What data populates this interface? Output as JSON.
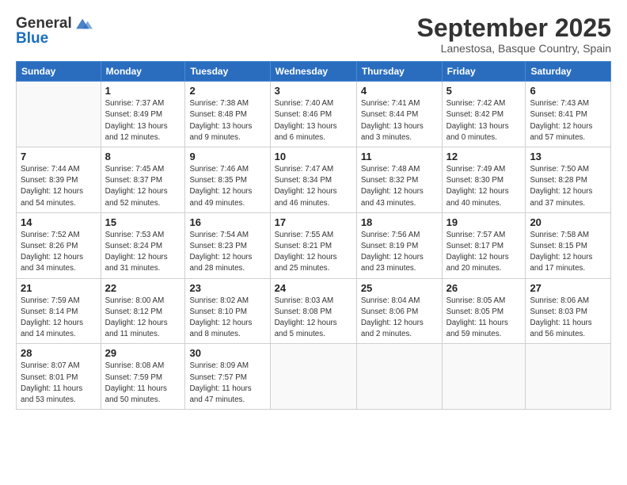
{
  "header": {
    "logo_line1": "General",
    "logo_line2": "Blue",
    "month_title": "September 2025",
    "location": "Lanestosa, Basque Country, Spain"
  },
  "weekdays": [
    "Sunday",
    "Monday",
    "Tuesday",
    "Wednesday",
    "Thursday",
    "Friday",
    "Saturday"
  ],
  "weeks": [
    [
      {
        "day": "",
        "info": ""
      },
      {
        "day": "1",
        "info": "Sunrise: 7:37 AM\nSunset: 8:49 PM\nDaylight: 13 hours\nand 12 minutes."
      },
      {
        "day": "2",
        "info": "Sunrise: 7:38 AM\nSunset: 8:48 PM\nDaylight: 13 hours\nand 9 minutes."
      },
      {
        "day": "3",
        "info": "Sunrise: 7:40 AM\nSunset: 8:46 PM\nDaylight: 13 hours\nand 6 minutes."
      },
      {
        "day": "4",
        "info": "Sunrise: 7:41 AM\nSunset: 8:44 PM\nDaylight: 13 hours\nand 3 minutes."
      },
      {
        "day": "5",
        "info": "Sunrise: 7:42 AM\nSunset: 8:42 PM\nDaylight: 13 hours\nand 0 minutes."
      },
      {
        "day": "6",
        "info": "Sunrise: 7:43 AM\nSunset: 8:41 PM\nDaylight: 12 hours\nand 57 minutes."
      }
    ],
    [
      {
        "day": "7",
        "info": "Sunrise: 7:44 AM\nSunset: 8:39 PM\nDaylight: 12 hours\nand 54 minutes."
      },
      {
        "day": "8",
        "info": "Sunrise: 7:45 AM\nSunset: 8:37 PM\nDaylight: 12 hours\nand 52 minutes."
      },
      {
        "day": "9",
        "info": "Sunrise: 7:46 AM\nSunset: 8:35 PM\nDaylight: 12 hours\nand 49 minutes."
      },
      {
        "day": "10",
        "info": "Sunrise: 7:47 AM\nSunset: 8:34 PM\nDaylight: 12 hours\nand 46 minutes."
      },
      {
        "day": "11",
        "info": "Sunrise: 7:48 AM\nSunset: 8:32 PM\nDaylight: 12 hours\nand 43 minutes."
      },
      {
        "day": "12",
        "info": "Sunrise: 7:49 AM\nSunset: 8:30 PM\nDaylight: 12 hours\nand 40 minutes."
      },
      {
        "day": "13",
        "info": "Sunrise: 7:50 AM\nSunset: 8:28 PM\nDaylight: 12 hours\nand 37 minutes."
      }
    ],
    [
      {
        "day": "14",
        "info": "Sunrise: 7:52 AM\nSunset: 8:26 PM\nDaylight: 12 hours\nand 34 minutes."
      },
      {
        "day": "15",
        "info": "Sunrise: 7:53 AM\nSunset: 8:24 PM\nDaylight: 12 hours\nand 31 minutes."
      },
      {
        "day": "16",
        "info": "Sunrise: 7:54 AM\nSunset: 8:23 PM\nDaylight: 12 hours\nand 28 minutes."
      },
      {
        "day": "17",
        "info": "Sunrise: 7:55 AM\nSunset: 8:21 PM\nDaylight: 12 hours\nand 25 minutes."
      },
      {
        "day": "18",
        "info": "Sunrise: 7:56 AM\nSunset: 8:19 PM\nDaylight: 12 hours\nand 23 minutes."
      },
      {
        "day": "19",
        "info": "Sunrise: 7:57 AM\nSunset: 8:17 PM\nDaylight: 12 hours\nand 20 minutes."
      },
      {
        "day": "20",
        "info": "Sunrise: 7:58 AM\nSunset: 8:15 PM\nDaylight: 12 hours\nand 17 minutes."
      }
    ],
    [
      {
        "day": "21",
        "info": "Sunrise: 7:59 AM\nSunset: 8:14 PM\nDaylight: 12 hours\nand 14 minutes."
      },
      {
        "day": "22",
        "info": "Sunrise: 8:00 AM\nSunset: 8:12 PM\nDaylight: 12 hours\nand 11 minutes."
      },
      {
        "day": "23",
        "info": "Sunrise: 8:02 AM\nSunset: 8:10 PM\nDaylight: 12 hours\nand 8 minutes."
      },
      {
        "day": "24",
        "info": "Sunrise: 8:03 AM\nSunset: 8:08 PM\nDaylight: 12 hours\nand 5 minutes."
      },
      {
        "day": "25",
        "info": "Sunrise: 8:04 AM\nSunset: 8:06 PM\nDaylight: 12 hours\nand 2 minutes."
      },
      {
        "day": "26",
        "info": "Sunrise: 8:05 AM\nSunset: 8:05 PM\nDaylight: 11 hours\nand 59 minutes."
      },
      {
        "day": "27",
        "info": "Sunrise: 8:06 AM\nSunset: 8:03 PM\nDaylight: 11 hours\nand 56 minutes."
      }
    ],
    [
      {
        "day": "28",
        "info": "Sunrise: 8:07 AM\nSunset: 8:01 PM\nDaylight: 11 hours\nand 53 minutes."
      },
      {
        "day": "29",
        "info": "Sunrise: 8:08 AM\nSunset: 7:59 PM\nDaylight: 11 hours\nand 50 minutes."
      },
      {
        "day": "30",
        "info": "Sunrise: 8:09 AM\nSunset: 7:57 PM\nDaylight: 11 hours\nand 47 minutes."
      },
      {
        "day": "",
        "info": ""
      },
      {
        "day": "",
        "info": ""
      },
      {
        "day": "",
        "info": ""
      },
      {
        "day": "",
        "info": ""
      }
    ]
  ]
}
